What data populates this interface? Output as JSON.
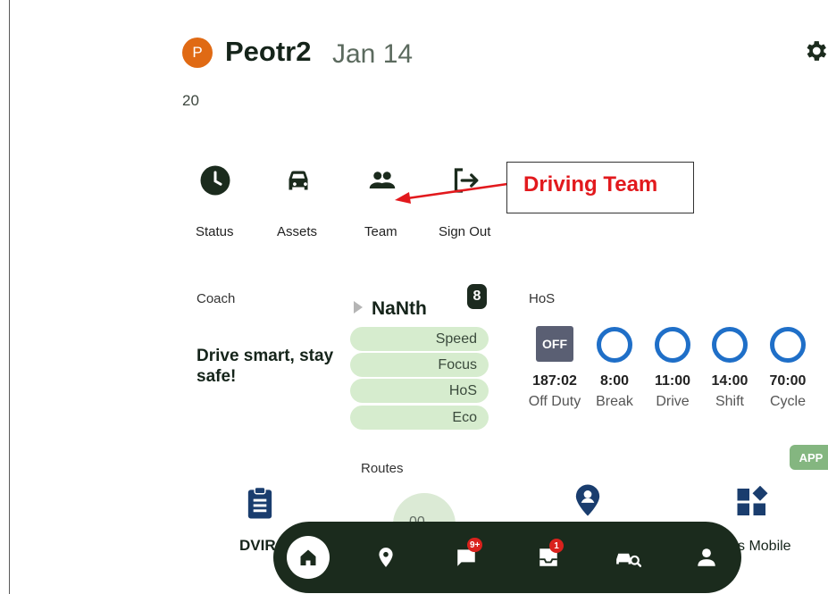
{
  "header": {
    "avatar_letter": "P",
    "username": "Peotr2",
    "date": "Jan 14",
    "year": "20"
  },
  "quick_actions": [
    {
      "label": "Status",
      "icon": "clock-icon"
    },
    {
      "label": "Assets",
      "icon": "car-icon"
    },
    {
      "label": "Team",
      "icon": "people-icon"
    },
    {
      "label": "Sign Out",
      "icon": "sign-out-icon"
    }
  ],
  "callout": {
    "text": "Driving Team",
    "color": "#e2191d"
  },
  "coach": {
    "title": "Coach",
    "message": "Drive smart, stay safe!",
    "score": "NaNth",
    "badge": "8",
    "categories": [
      "Speed",
      "Focus",
      "HoS",
      "Eco"
    ]
  },
  "hos": {
    "title": "HoS",
    "status": "OFF",
    "metrics": [
      {
        "value": "187:02",
        "label": "Off Duty"
      },
      {
        "value": "8:00",
        "label": "Break"
      },
      {
        "value": "11:00",
        "label": "Drive"
      },
      {
        "value": "14:00",
        "label": "Shift"
      },
      {
        "value": "70:00",
        "label": "Cycle"
      }
    ]
  },
  "app_tag": "APP",
  "routes": {
    "title": "Routes",
    "dial_value": "00"
  },
  "tiles": {
    "dvir_label": "DVIR",
    "mobile_label": "s Mobile"
  },
  "nav": {
    "messages_badge": "9+",
    "inbox_badge": "1"
  },
  "colors": {
    "accent_blue": "#1f6fc8",
    "nav_bg": "#1b2b1d",
    "avatar": "#e06a14",
    "pill_bg": "#d6ecce"
  }
}
